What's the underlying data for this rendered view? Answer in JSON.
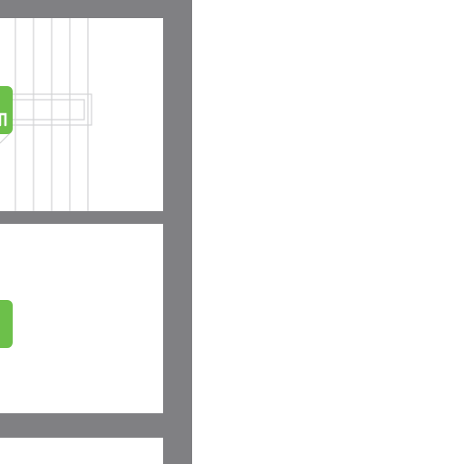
{
  "diagram": {
    "kind": "building-cross-section",
    "wall_color": "#808083",
    "floor_color": "#808083",
    "background_color": "#ffffff",
    "stair_line_color": "#d2d3d4",
    "marker_color": "#6cc04a",
    "marker_icon": "exit-sign-icon",
    "floors": [
      {
        "name": "upper-floor",
        "has_stairs": true,
        "has_exit_marker": true
      },
      {
        "name": "middle-floor",
        "has_stairs": false,
        "has_exit_marker": true
      },
      {
        "name": "lower-floor",
        "has_stairs": false,
        "has_exit_marker": false
      }
    ]
  }
}
